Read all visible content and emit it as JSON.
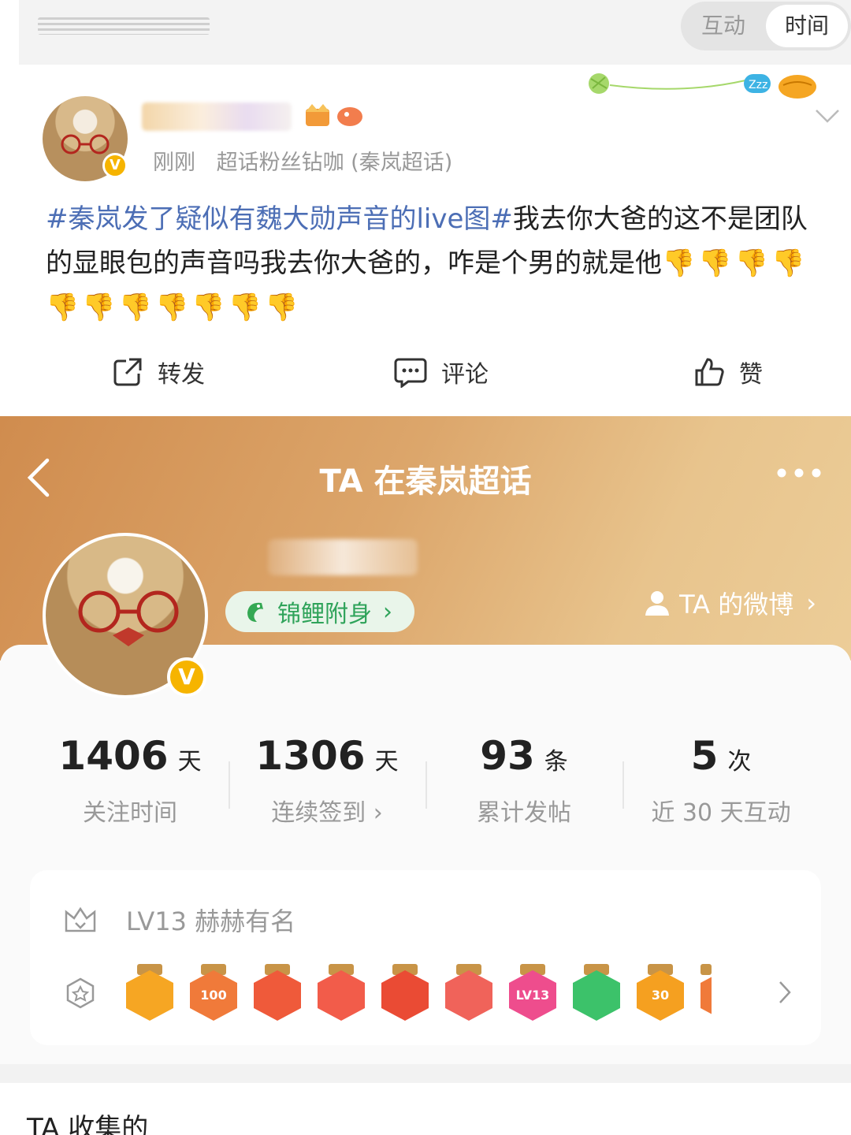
{
  "segment": {
    "tab1": "互动",
    "tab2": "时间"
  },
  "post": {
    "time": "刚刚",
    "source": "超话粉丝钻咖 (秦岚超话)",
    "hashtag1": "#秦岚发了疑似有魏大勋声音的live图#",
    "body": "我去你大爸的这不是团队的显眼包的声音吗我去你大爸的，咋是个男的就是他",
    "emojis": "👎👎👎👎👎👎👎👎👎👎👎",
    "actions": {
      "repost": "转发",
      "comment": "评论",
      "like": "赞"
    }
  },
  "profile": {
    "title": "TA 在秦岚超话",
    "koi_label": "锦鲤附身",
    "ta_weibo": "TA 的微博",
    "verified_badge": "V",
    "stats": [
      {
        "value": "1406",
        "unit": "天",
        "label": "关注时间"
      },
      {
        "value": "1306",
        "unit": "天",
        "label": "连续签到 ›"
      },
      {
        "value": "93",
        "unit": "条",
        "label": "累计发帖"
      },
      {
        "value": "5",
        "unit": "次",
        "label": "近 30 天互动"
      }
    ],
    "level": "LV13 赫赫有名",
    "medal_texts": [
      "",
      "100",
      "",
      "",
      "",
      "",
      "LV13",
      "",
      "30"
    ],
    "collected_title": "TA 收集的"
  },
  "colors": {
    "accent_blue": "#4c6eb5",
    "koi_green": "#2fa35a",
    "vip_gold": "#f6b400",
    "hero_start": "#d08c4e",
    "hero_end": "#eccd98"
  }
}
